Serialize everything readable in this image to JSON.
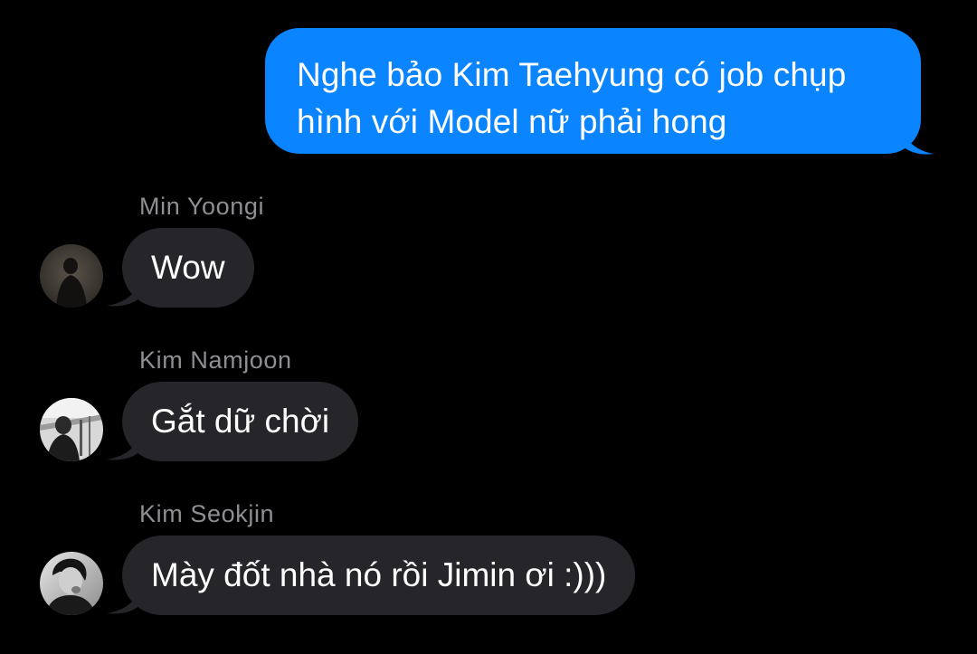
{
  "colors": {
    "background": "#000000",
    "outgoing_bubble": "#0A84FF",
    "incoming_bubble": "#26252A",
    "sender_name": "#8E8E93",
    "text": "#FFFFFF"
  },
  "outgoing": {
    "line1": "Nghe bảo Kim Taehyung có job chụp",
    "line2": "hình với Model nữ phải hong"
  },
  "messages": [
    {
      "sender": "Min Yoongi",
      "text": "Wow",
      "avatar": "avatar-photo"
    },
    {
      "sender": "Kim Namjoon",
      "text": "Gắt dữ chời",
      "avatar": "avatar-photo"
    },
    {
      "sender": "Kim Seokjin",
      "text": "Mày đốt nhà nó rồi Jimin ơi :)))",
      "avatar": "avatar-photo"
    }
  ]
}
